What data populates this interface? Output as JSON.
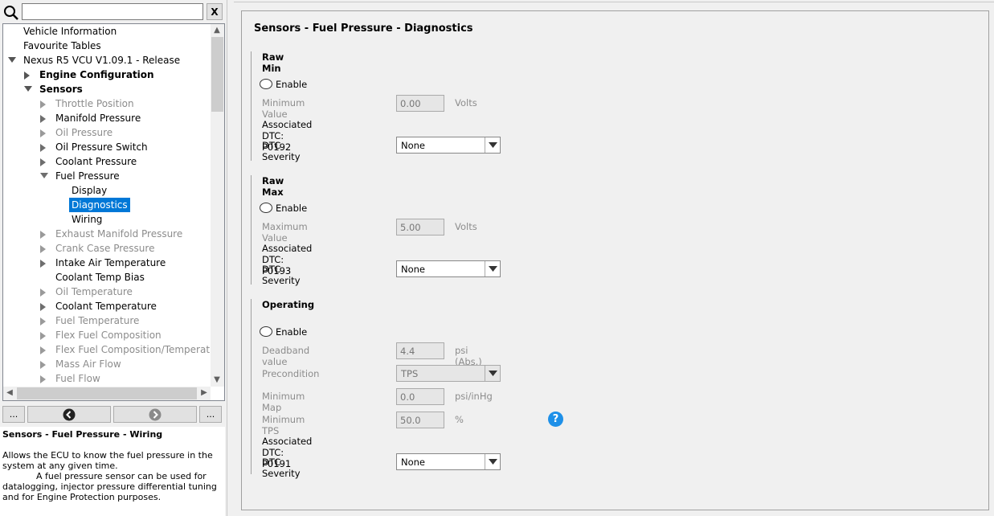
{
  "search": {
    "value": "",
    "placeholder": "",
    "clear_label": "X"
  },
  "tree": [
    {
      "label": "Vehicle Information",
      "arrow": "none",
      "indent": 0,
      "state": "normal"
    },
    {
      "label": "Favourite Tables",
      "arrow": "none",
      "indent": 0,
      "state": "normal"
    },
    {
      "label": "Nexus R5 VCU V1.09.1 - Release",
      "arrow": "expanded",
      "indent": 0,
      "state": "normal"
    },
    {
      "label": "Engine Configuration",
      "arrow": "collapsed",
      "indent": 1,
      "state": "bold"
    },
    {
      "label": "Sensors",
      "arrow": "expanded",
      "indent": 1,
      "state": "bold"
    },
    {
      "label": "Throttle Position",
      "arrow": "collapsed",
      "indent": 2,
      "state": "disabled"
    },
    {
      "label": "Manifold Pressure",
      "arrow": "collapsed",
      "indent": 2,
      "state": "normal"
    },
    {
      "label": "Oil Pressure",
      "arrow": "collapsed",
      "indent": 2,
      "state": "disabled"
    },
    {
      "label": "Oil Pressure Switch",
      "arrow": "collapsed",
      "indent": 2,
      "state": "normal"
    },
    {
      "label": "Coolant Pressure",
      "arrow": "collapsed",
      "indent": 2,
      "state": "normal"
    },
    {
      "label": "Fuel Pressure",
      "arrow": "expanded",
      "indent": 2,
      "state": "normal"
    },
    {
      "label": "Display",
      "arrow": "none",
      "indent": 3,
      "state": "normal"
    },
    {
      "label": "Diagnostics",
      "arrow": "none",
      "indent": 3,
      "state": "selected"
    },
    {
      "label": "Wiring",
      "arrow": "none",
      "indent": 3,
      "state": "normal"
    },
    {
      "label": "Exhaust Manifold Pressure",
      "arrow": "collapsed",
      "indent": 2,
      "state": "disabled"
    },
    {
      "label": "Crank Case Pressure",
      "arrow": "collapsed",
      "indent": 2,
      "state": "disabled"
    },
    {
      "label": "Intake Air Temperature",
      "arrow": "collapsed",
      "indent": 2,
      "state": "normal"
    },
    {
      "label": "Coolant Temp Bias",
      "arrow": "none",
      "indent": 2,
      "state": "normal"
    },
    {
      "label": "Oil Temperature",
      "arrow": "collapsed",
      "indent": 2,
      "state": "disabled"
    },
    {
      "label": "Coolant Temperature",
      "arrow": "collapsed",
      "indent": 2,
      "state": "normal"
    },
    {
      "label": "Fuel Temperature",
      "arrow": "collapsed",
      "indent": 2,
      "state": "disabled"
    },
    {
      "label": "Flex Fuel Composition",
      "arrow": "collapsed",
      "indent": 2,
      "state": "disabled"
    },
    {
      "label": "Flex Fuel Composition/Temperature S",
      "arrow": "collapsed",
      "indent": 2,
      "state": "disabled"
    },
    {
      "label": "Mass Air Flow",
      "arrow": "collapsed",
      "indent": 2,
      "state": "disabled"
    },
    {
      "label": "Fuel Flow",
      "arrow": "collapsed",
      "indent": 2,
      "state": "disabled"
    }
  ],
  "nav": {
    "more_left": "...",
    "more_right": "..."
  },
  "description": {
    "title": "Sensors - Fuel Pressure - Wiring",
    "body": "Allows the ECU to know the fuel pressure in the system at any given time.\n            A fuel pressure sensor can be used for datalogging, injector pressure differential tuning and for Engine Protection purposes."
  },
  "page_title": "Sensors - Fuel Pressure - Diagnostics",
  "raw_min": {
    "title": "Raw Min",
    "enable": "Enable",
    "min_label": "Minimum Value",
    "min_value": "0.00",
    "min_unit": "Volts",
    "dtc": "Associated DTC: P0192",
    "severity_label": "DTC Severity",
    "severity": "None"
  },
  "raw_max": {
    "title": "Raw Max",
    "enable": "Enable",
    "max_label": "Maximum Value",
    "max_value": "5.00",
    "max_unit": "Volts",
    "dtc": "Associated DTC: P0193",
    "severity_label": "DTC Severity",
    "severity": "None"
  },
  "operating": {
    "title": "Operating",
    "enable": "Enable",
    "deadband_label": "Deadband value",
    "deadband_value": "4.4",
    "deadband_unit": "psi (Abs.)",
    "precondition_label": "Precondition",
    "precondition": "TPS",
    "min_map_label": "Minimum Map",
    "min_map_value": "0.0",
    "min_map_unit": "psi/inHg",
    "min_tps_label": "Minimum TPS",
    "min_tps_value": "50.0",
    "min_tps_unit": "%",
    "help": "?",
    "dtc": "Associated DTC: P0191",
    "severity_label": "DTC Severity",
    "severity": "None"
  }
}
